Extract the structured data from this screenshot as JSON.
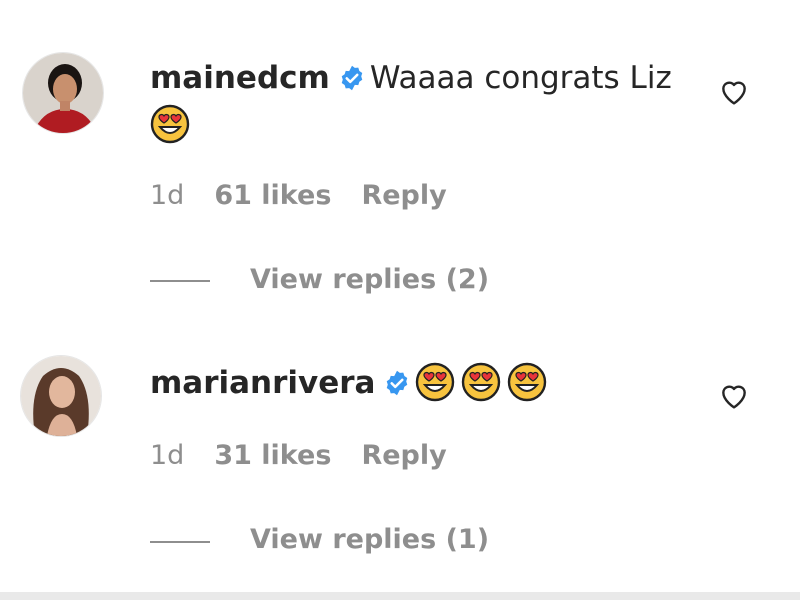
{
  "comments": [
    {
      "username": "mainedcm",
      "text": "Waaaa congrats Liz",
      "time": "1d",
      "likes": "61 likes",
      "reply": "Reply",
      "view_replies": "View replies (2)"
    },
    {
      "username": "marianrivera",
      "text": "",
      "time": "1d",
      "likes": "31 likes",
      "reply": "Reply",
      "view_replies": "View replies (1)"
    }
  ],
  "icons": {
    "verified": "verified-badge-icon",
    "heart": "heart-outline-icon",
    "emoji": "heart-eyes-emoji-icon"
  },
  "colors": {
    "verified_blue": "#3897f0",
    "muted_text": "#8e8e8e",
    "primary_text": "#262626"
  }
}
